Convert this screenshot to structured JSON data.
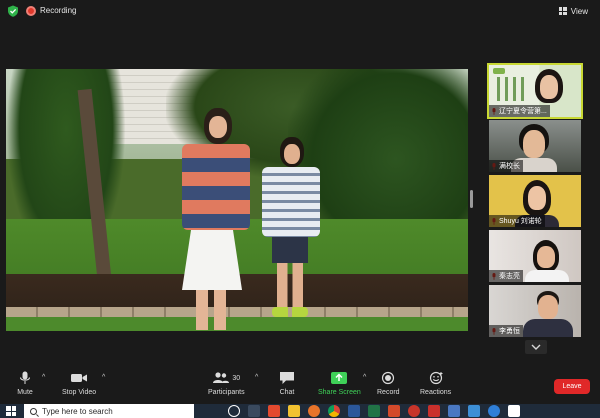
{
  "header": {
    "recording_label": "Recording",
    "view_label": "View"
  },
  "gallery": {
    "participants": [
      {
        "name": "辽宁夏令营第..."
      },
      {
        "name": "满校长"
      },
      {
        "name": "Shuyu 刘诺轮"
      },
      {
        "name": "秦志亮"
      },
      {
        "name": "李勇恒"
      }
    ]
  },
  "toolbar": {
    "mute_label": "Mute",
    "stop_video_label": "Stop Video",
    "participants_label": "Participants",
    "participants_count": "30",
    "chat_label": "Chat",
    "share_screen_label": "Share Screen",
    "record_label": "Record",
    "reactions_label": "Reactions",
    "leave_label": "Leave"
  },
  "taskbar": {
    "search_placeholder": "Type here to search"
  },
  "colors": {
    "share_green": "#3fd158",
    "leave_red": "#e02828",
    "active_speaker_outline": "#c8d833",
    "recording_red": "#e0382b"
  },
  "icons": [
    "shield-icon",
    "recording-icon",
    "view-grid-icon",
    "microphone-icon",
    "video-camera-icon",
    "participants-icon",
    "chat-bubble-icon",
    "share-screen-arrow-icon",
    "record-icon",
    "reactions-smiley-icon",
    "chevron-down-icon",
    "windows-logo-icon",
    "search-icon"
  ]
}
